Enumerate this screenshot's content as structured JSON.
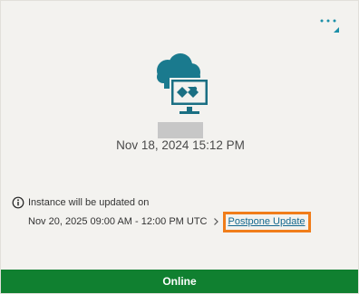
{
  "card": {
    "menu_icon": "more-dots-icon",
    "hero_icon": "cloud-monitor-icon",
    "timestamp": "Nov 18, 2024 15:12 PM",
    "update_notice": {
      "info_icon": "info-icon",
      "label": "Instance will be updated on",
      "schedule": "Nov 20, 2025 09:00 AM - 12:00 PM UTC",
      "chevron_icon": "chevron-right-icon",
      "postpone_label": "Postpone Update"
    },
    "status": "Online"
  },
  "colors": {
    "teal_icon": "#1a6f83",
    "teal_accent": "#1b8fa8",
    "status_green": "#108030",
    "highlight_orange": "#f07d1a",
    "link": "#13688f"
  }
}
